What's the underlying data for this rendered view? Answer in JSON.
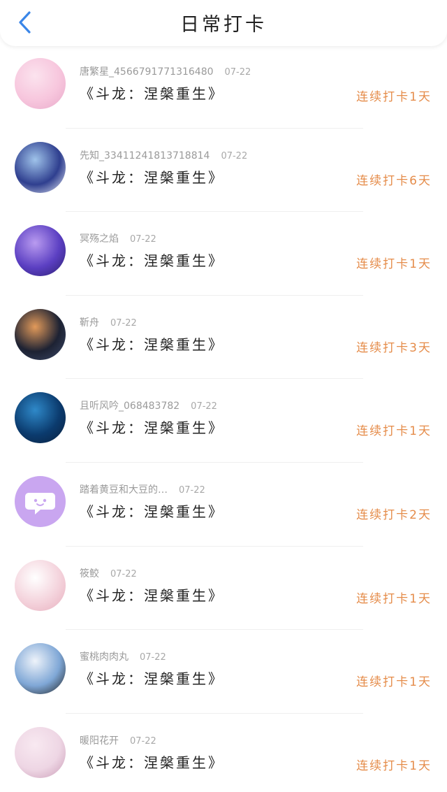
{
  "header": {
    "title": "日常打卡",
    "back_icon": "chevron-left-icon",
    "accent": "#3a86e8"
  },
  "colors": {
    "streak": "#e58c4a",
    "meta": "#9a9a9a"
  },
  "items": [
    {
      "user": "唐繁星_456679177131648​0",
      "date": "07-22",
      "book": "《斗龙：涅槃重生》",
      "streak": "连续打卡1天",
      "avatar_colors": [
        "#f7c6dd",
        "#fbe3ee",
        "#e8a9c9"
      ]
    },
    {
      "user": "先知_33411241813718814",
      "date": "07-22",
      "book": "《斗龙：涅槃重生》",
      "streak": "连续打卡6天",
      "avatar_colors": [
        "#2f3f8f",
        "#9fc3ea",
        "#e9eef8"
      ]
    },
    {
      "user": "冥殇之焰",
      "date": "07-22",
      "book": "《斗龙：涅槃重生》",
      "streak": "连续打卡1天",
      "avatar_colors": [
        "#5b3fc2",
        "#b99bf0",
        "#2a1e6e"
      ]
    },
    {
      "user": "靳舟",
      "date": "07-22",
      "book": "《斗龙：涅槃重生》",
      "streak": "连续打卡3天",
      "avatar_colors": [
        "#1d2233",
        "#e29a5a",
        "#3d4a6a"
      ]
    },
    {
      "user": "且听风吟_068483782",
      "date": "07-22",
      "book": "《斗龙：涅槃重生》",
      "streak": "连续打卡1天",
      "avatar_colors": [
        "#0b3b6e",
        "#2f89c9",
        "#0a1f3c"
      ]
    },
    {
      "user": "踏着黄豆和大豆的…",
      "date": "07-22",
      "book": "《斗龙：涅槃重生》",
      "streak": "连续打卡2天",
      "avatar_colors": [
        "#c9a6f0",
        "#c9a6f0",
        "#ffffff"
      ]
    },
    {
      "user": "筱鲛",
      "date": "07-22",
      "book": "《斗龙：涅槃重生》",
      "streak": "连续打卡1天",
      "avatar_colors": [
        "#f4d3dc",
        "#ffffff",
        "#e7aebd"
      ]
    },
    {
      "user": "蜜桃肉肉丸",
      "date": "07-22",
      "book": "《斗龙：涅槃重生》",
      "streak": "连续打卡1天",
      "avatar_colors": [
        "#7fa7d6",
        "#eef3fa",
        "#1c1c1c"
      ]
    },
    {
      "user": "暖阳花开",
      "date": "07-22",
      "book": "《斗龙：涅槃重生》",
      "streak": "连续打卡1天",
      "avatar_colors": [
        "#eed6e4",
        "#f8e9f1",
        "#c99bb6"
      ]
    }
  ]
}
